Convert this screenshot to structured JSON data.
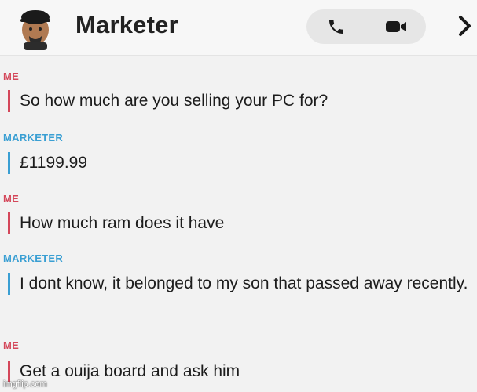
{
  "header": {
    "contact_name": "Marketer",
    "icons": {
      "avatar": "bitmoji-avatar-icon",
      "call": "phone-icon",
      "video": "video-camera-icon",
      "more": "chevron-right-icon"
    }
  },
  "colors": {
    "me": "#d4475a",
    "marketer": "#3a9fd3",
    "text": "#1c1c1c",
    "background": "#f2f2f2"
  },
  "messages": [
    {
      "sender": "ME",
      "text": "So how much are you selling your PC for?"
    },
    {
      "sender": "MARKETER",
      "text": "£1199.99"
    },
    {
      "sender": "ME",
      "text": "How much ram does it have"
    },
    {
      "sender": "MARKETER",
      "text": "I dont know, it belonged to my son that passed away recently."
    },
    {
      "sender": "ME",
      "text": "Get a ouija board and ask him"
    }
  ],
  "watermark": "imgflip.com"
}
